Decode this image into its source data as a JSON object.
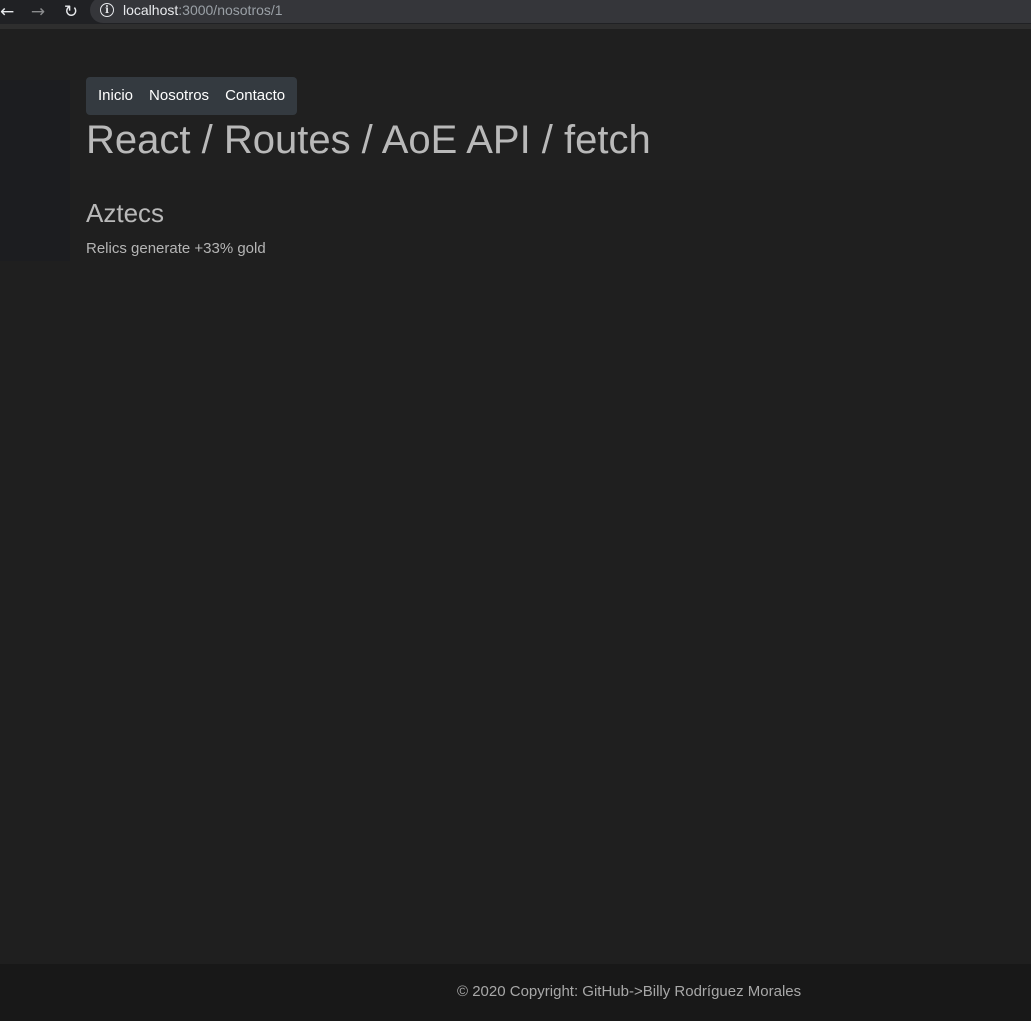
{
  "browser": {
    "back_icon": "arrow-left-icon",
    "forward_icon": "arrow-right-icon",
    "reload_icon": "reload-icon",
    "info_icon": "info-icon",
    "url_host": "localhost",
    "url_rest": ":3000/nosotros/1"
  },
  "navbar": {
    "items": [
      {
        "label": "Inicio"
      },
      {
        "label": "Nosotros"
      },
      {
        "label": "Contacto"
      }
    ]
  },
  "page": {
    "title": "React / Routes / AoE API / fetch"
  },
  "civilization": {
    "name": "Aztecs",
    "bonus": "Relics generate +33% gold"
  },
  "footer": {
    "text": "© 2020 Copyright: GitHub->Billy Rodríguez Morales"
  },
  "colors": {
    "background": "#1f1f1f",
    "navbar": "#343a40",
    "footer": "#181818"
  }
}
